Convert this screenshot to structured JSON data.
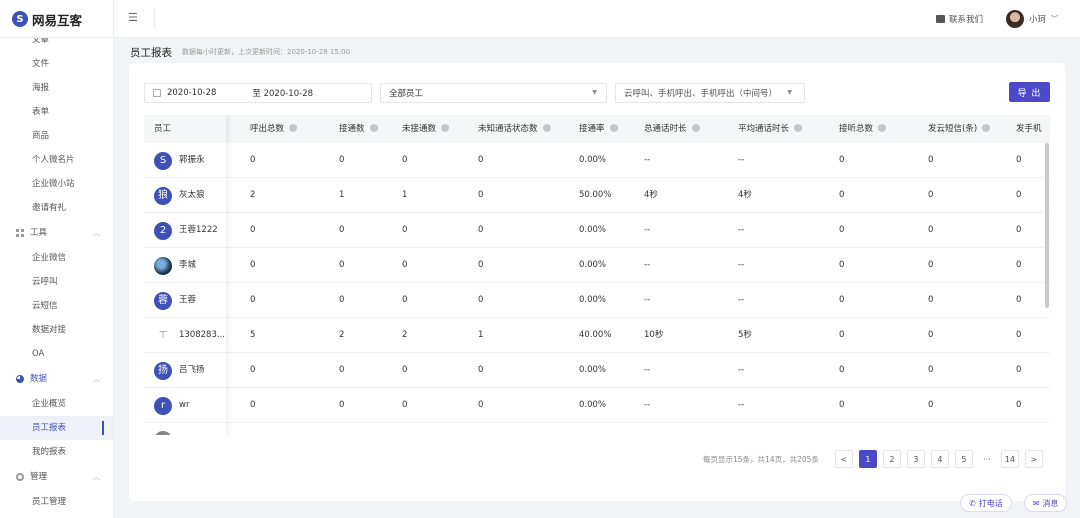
{
  "brand": {
    "name": "网易互客",
    "mark": "S"
  },
  "sidebar": {
    "pre_items": [
      "文章",
      "文件",
      "海报",
      "表单",
      "商品",
      "个人微名片",
      "企业微小站",
      "邀请有礼"
    ],
    "groups": [
      {
        "label": "工具",
        "items": [
          "企业微信",
          "云呼叫",
          "云短信",
          "数据对接",
          "OA"
        ]
      },
      {
        "label": "数据",
        "items": [
          "企业概览",
          "员工报表",
          "我的报表"
        ]
      },
      {
        "label": "管理",
        "items": [
          "员工管理"
        ]
      }
    ]
  },
  "topbar": {
    "contact_label": "联系我们",
    "user_name": "小珂"
  },
  "page": {
    "title": "员工报表",
    "subtitle": "数据每小时更新，上次更新时间：2020-10-28 15:00"
  },
  "filters": {
    "date_start": "2020-10-28",
    "date_end": "至 2020-10-28",
    "employee": "全部员工",
    "call_type": "云呼叫、手机呼出、手机呼出（中间号）",
    "export_label": "导 出"
  },
  "table": {
    "columns": [
      "员工",
      "呼出总数",
      "接通数",
      "未接通数",
      "未知通话状态数",
      "接通率",
      "总通话时长",
      "平均通话时长",
      "接听总数",
      "发云短信(条)",
      "发手机"
    ],
    "rows": [
      {
        "avatar": "S",
        "name": "郭振永",
        "cells": [
          "0",
          "0",
          "0",
          "0",
          "0.00%",
          "--",
          "--",
          "0",
          "0",
          "0"
        ]
      },
      {
        "avatar": "狼",
        "name": "灰太狼",
        "cells": [
          "2",
          "1",
          "1",
          "0",
          "50.00%",
          "4秒",
          "4秒",
          "0",
          "0",
          "0"
        ]
      },
      {
        "avatar": "2",
        "name": "王蓉1222",
        "cells": [
          "0",
          "0",
          "0",
          "0",
          "0.00%",
          "--",
          "--",
          "0",
          "0",
          "0"
        ]
      },
      {
        "avatar": "",
        "name": "李城",
        "cells": [
          "0",
          "0",
          "0",
          "0",
          "0.00%",
          "--",
          "--",
          "0",
          "0",
          "0"
        ]
      },
      {
        "avatar": "蓉",
        "name": "王蓉",
        "cells": [
          "0",
          "0",
          "0",
          "0",
          "0.00%",
          "--",
          "--",
          "0",
          "0",
          "0"
        ]
      },
      {
        "avatar": "",
        "name": "1308283...",
        "cells": [
          "5",
          "2",
          "2",
          "1",
          "40.00%",
          "10秒",
          "5秒",
          "0",
          "0",
          "0"
        ]
      },
      {
        "avatar": "扬",
        "name": "吕飞扬",
        "cells": [
          "0",
          "0",
          "0",
          "0",
          "0.00%",
          "--",
          "--",
          "0",
          "0",
          "0"
        ]
      },
      {
        "avatar": "r",
        "name": "wr",
        "cells": [
          "0",
          "0",
          "0",
          "0",
          "0.00%",
          "--",
          "--",
          "0",
          "0",
          "0"
        ]
      }
    ]
  },
  "pagination": {
    "summary": "每页显示15条，共14页，共205条",
    "pages": [
      "1",
      "2",
      "3",
      "4",
      "5"
    ],
    "current": "1",
    "last": "14",
    "prev": "<",
    "next": ">",
    "ellipsis": "···"
  },
  "float_buttons": {
    "call": "打电话",
    "message": "消息"
  },
  "colors": {
    "primary": "#4b49c8",
    "brand": "#3f51b5"
  }
}
